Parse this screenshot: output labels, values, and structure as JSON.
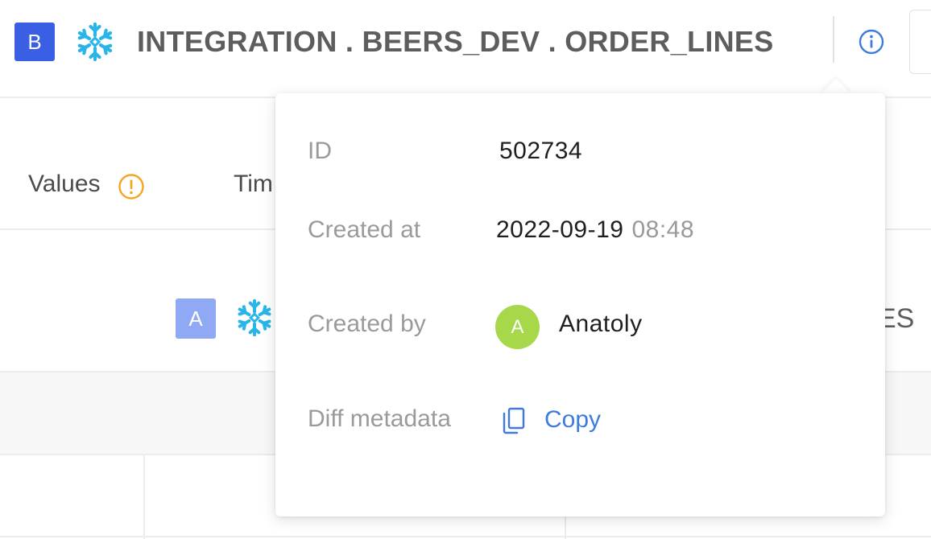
{
  "header": {
    "badge": "B",
    "title": "INTEGRATION . BEERS_DEV . ORDER_LINES",
    "icons": {
      "source": "snowflake-icon",
      "info": "info-icon"
    }
  },
  "tabs": {
    "values_label": "Values",
    "time_label_partial": "Tim",
    "values_icon": "warning-icon"
  },
  "row": {
    "badge": "A",
    "trailing_text": "ES"
  },
  "popover": {
    "id_label": "ID",
    "id_value": "502734",
    "created_at_label": "Created at",
    "created_at_date": "2022-09-19",
    "created_at_time": "08:48",
    "created_by_label": "Created by",
    "avatar_initial": "A",
    "created_by_name": "Anatoly",
    "diff_label": "Diff metadata",
    "copy_label": "Copy"
  },
  "colors": {
    "badge_b": "#3a5fe5",
    "badge_a": "#8fa9f5",
    "snowflake": "#29b5e8",
    "link": "#3d7be0",
    "warning": "#f5a623",
    "avatar": "#a6d84a"
  }
}
